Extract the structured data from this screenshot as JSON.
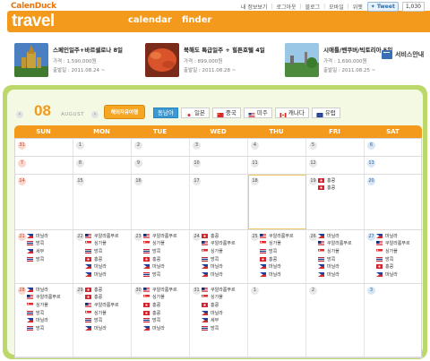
{
  "header": {
    "logo_top": "CalenDuck",
    "logo_main": "travel",
    "nav": [
      "calendar",
      "finder"
    ],
    "top_links": [
      "내 정보보기",
      "로그아웃",
      "블로그",
      "모바일",
      "위젯"
    ],
    "tweet_label": "Tweet",
    "tweet_count": "1,030"
  },
  "banner": {
    "promos": [
      {
        "title": "스페인일주+바르셀로나 8일",
        "price": "가격 : 1,590,000원",
        "date": "출발일 : 2011.08.24 ~"
      },
      {
        "title": "북해도 특급일주 + 힐튼호텔 4일",
        "price": "가격 : 899,000원",
        "date": "출발일 : 2011.08.28 ~"
      },
      {
        "title": "시애틀/밴쿠버/빅토리아 5일",
        "price": "가격 : 1,690,000원",
        "date": "출발일 : 2011.08.25 ~"
      }
    ],
    "service_guide": "서비스안내"
  },
  "calendar": {
    "month_number": "08",
    "month_name": "AUGUST",
    "region_badge": "해외자유여행",
    "prev_label": "‹",
    "next_label": "›",
    "tabs": [
      {
        "label": "동남아",
        "active": true,
        "flag": ""
      },
      {
        "label": "일본",
        "active": false,
        "flag": "japan"
      },
      {
        "label": "중국",
        "active": false,
        "flag": "china"
      },
      {
        "label": "미주",
        "active": false,
        "flag": "usa"
      },
      {
        "label": "캐나다",
        "active": false,
        "flag": "canada"
      },
      {
        "label": "유럽",
        "active": false,
        "flag": "eu"
      }
    ],
    "weekdays": [
      "SUN",
      "MON",
      "TUE",
      "WED",
      "THU",
      "FRI",
      "SAT"
    ],
    "weeks": [
      [
        {
          "day": "31",
          "events": []
        },
        {
          "day": "1",
          "events": []
        },
        {
          "day": "2",
          "events": []
        },
        {
          "day": "3",
          "events": []
        },
        {
          "day": "4",
          "events": []
        },
        {
          "day": "5",
          "events": []
        },
        {
          "day": "6",
          "events": []
        }
      ],
      [
        {
          "day": "7",
          "events": []
        },
        {
          "day": "8",
          "events": []
        },
        {
          "day": "9",
          "events": []
        },
        {
          "day": "10",
          "events": []
        },
        {
          "day": "11",
          "events": []
        },
        {
          "day": "12",
          "events": []
        },
        {
          "day": "13",
          "events": []
        }
      ],
      [
        {
          "day": "14",
          "events": []
        },
        {
          "day": "15",
          "events": []
        },
        {
          "day": "16",
          "events": []
        },
        {
          "day": "17",
          "events": []
        },
        {
          "day": "18",
          "events": [],
          "today": true
        },
        {
          "day": "19",
          "events": [
            {
              "flag": "hk",
              "label": "홍콩"
            },
            {
              "flag": "hk",
              "label": "홍콩"
            }
          ]
        },
        {
          "day": "20",
          "events": []
        }
      ],
      [
        {
          "day": "21",
          "events": [
            {
              "flag": "ph",
              "label": "마닐라"
            },
            {
              "flag": "th",
              "label": "방콕"
            },
            {
              "flag": "ph",
              "label": "세부"
            },
            {
              "flag": "th",
              "label": "방콕"
            }
          ]
        },
        {
          "day": "22",
          "events": [
            {
              "flag": "my",
              "label": "쿠알라룸푸르"
            },
            {
              "flag": "sg",
              "label": "싱가폴"
            },
            {
              "flag": "th",
              "label": "방콕"
            },
            {
              "flag": "hk",
              "label": "홍콩"
            },
            {
              "flag": "ph",
              "label": "마닐라"
            },
            {
              "flag": "ph",
              "label": "마닐라"
            }
          ]
        },
        {
          "day": "23",
          "events": [
            {
              "flag": "my",
              "label": "쿠알라룸푸르"
            },
            {
              "flag": "sg",
              "label": "싱가폴"
            },
            {
              "flag": "th",
              "label": "방콕"
            },
            {
              "flag": "hk",
              "label": "홍콩"
            },
            {
              "flag": "ph",
              "label": "마닐라"
            },
            {
              "flag": "th",
              "label": "방콕"
            }
          ]
        },
        {
          "day": "24",
          "events": [
            {
              "flag": "hk",
              "label": "홍콩"
            },
            {
              "flag": "my",
              "label": "쿠알라룸푸르"
            },
            {
              "flag": "sg",
              "label": "싱가폴"
            },
            {
              "flag": "th",
              "label": "방콕"
            },
            {
              "flag": "ph",
              "label": "마닐라"
            },
            {
              "flag": "ph",
              "label": "마닐라"
            }
          ]
        },
        {
          "day": "25",
          "events": [
            {
              "flag": "my",
              "label": "쿠알라룸푸르"
            },
            {
              "flag": "sg",
              "label": "싱가폴"
            },
            {
              "flag": "th",
              "label": "방콕"
            },
            {
              "flag": "hk",
              "label": "홍콩"
            },
            {
              "flag": "ph",
              "label": "마닐라"
            },
            {
              "flag": "ph",
              "label": "마닐라"
            }
          ]
        },
        {
          "day": "26",
          "events": [
            {
              "flag": "ph",
              "label": "마닐라"
            },
            {
              "flag": "my",
              "label": "쿠알라룸푸르"
            },
            {
              "flag": "sg",
              "label": "싱가폴"
            },
            {
              "flag": "th",
              "label": "방콕"
            },
            {
              "flag": "ph",
              "label": "마닐라"
            },
            {
              "flag": "ph",
              "label": "마닐라"
            }
          ]
        },
        {
          "day": "27",
          "events": [
            {
              "flag": "ph",
              "label": "마닐라"
            },
            {
              "flag": "my",
              "label": "쿠알라룸푸르"
            },
            {
              "flag": "sg",
              "label": "싱가폴"
            },
            {
              "flag": "th",
              "label": "방콕"
            },
            {
              "flag": "hk",
              "label": "홍콩"
            },
            {
              "flag": "ph",
              "label": "마닐라"
            }
          ]
        }
      ],
      [
        {
          "day": "28",
          "events": [
            {
              "flag": "ph",
              "label": "마닐라"
            },
            {
              "flag": "my",
              "label": "쿠알라룸푸르"
            },
            {
              "flag": "sg",
              "label": "싱가폴"
            },
            {
              "flag": "th",
              "label": "방콕"
            },
            {
              "flag": "ph",
              "label": "마닐라"
            },
            {
              "flag": "th",
              "label": "방콕"
            }
          ]
        },
        {
          "day": "29",
          "events": [
            {
              "flag": "hk",
              "label": "홍콩"
            },
            {
              "flag": "hk",
              "label": "홍콩"
            },
            {
              "flag": "my",
              "label": "쿠알라룸푸르"
            },
            {
              "flag": "sg",
              "label": "싱가폴"
            },
            {
              "flag": "th",
              "label": "방콕"
            },
            {
              "flag": "ph",
              "label": "마닐라"
            }
          ]
        },
        {
          "day": "30",
          "events": [
            {
              "flag": "my",
              "label": "쿠알라룸푸르"
            },
            {
              "flag": "sg",
              "label": "싱가폴"
            },
            {
              "flag": "hk",
              "label": "홍콩"
            },
            {
              "flag": "hk",
              "label": "홍콩"
            },
            {
              "flag": "th",
              "label": "방콕"
            },
            {
              "flag": "ph",
              "label": "마닐라"
            }
          ]
        },
        {
          "day": "31",
          "events": [
            {
              "flag": "my",
              "label": "쿠알라룸푸르"
            },
            {
              "flag": "sg",
              "label": "싱가폴"
            },
            {
              "flag": "hk",
              "label": "홍콩"
            },
            {
              "flag": "ph",
              "label": "마닐라"
            },
            {
              "flag": "ph",
              "label": "세부"
            },
            {
              "flag": "th",
              "label": "방콕"
            }
          ]
        },
        {
          "day": "1",
          "events": []
        },
        {
          "day": "2",
          "events": []
        },
        {
          "day": "3",
          "events": []
        }
      ]
    ]
  },
  "colors": {
    "accent_orange": "#f39a1c",
    "panel_green": "#bdd86a",
    "tab_active_blue": "#3b9ad3"
  }
}
